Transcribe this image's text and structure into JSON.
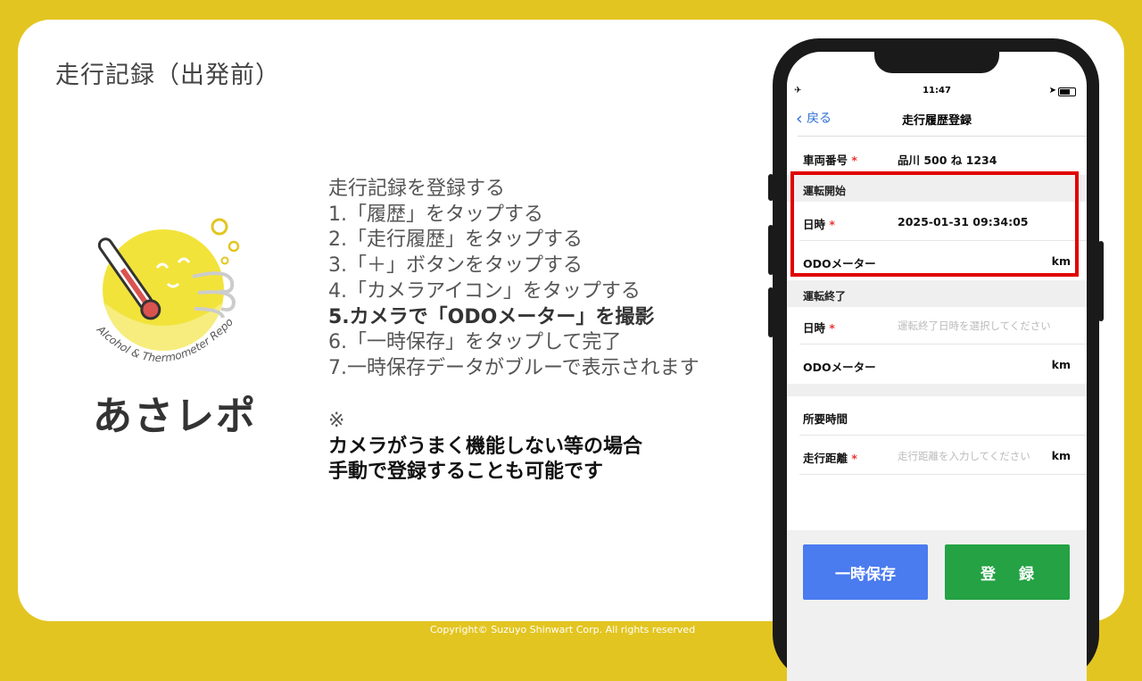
{
  "slide": {
    "title": "走行記録（出発前）",
    "steps": [
      "走行記録を登録する",
      "1.「履歴」をタップする",
      "2.「走行履歴」をタップする",
      "3.「＋」ボタンをタップする",
      "4.「カメラアイコン」をタップする",
      "5.カメラで「ODOメーター」を撮影",
      "6.「一時保存」をタップして完了",
      "7.一時保存データがブルーで表示されます"
    ],
    "note_mark": "※",
    "note_lines": [
      "カメラがうまく機能しない等の場合",
      "手動で登録することも可能です"
    ],
    "footer": "Copyright© Suzuyo Shinwart Corp. All rights reserved"
  },
  "logo": {
    "text": "あさレポ",
    "arc_text": "Alcohol & Thermometer Report",
    "colors": {
      "yellow": "#f2e33a",
      "dark_yellow": "#e3c521"
    }
  },
  "phone": {
    "status": {
      "time": "11:47",
      "plane_icon": "✈",
      "location_icon": "➤"
    },
    "nav": {
      "back_label": "戻る",
      "title": "走行履歴登録"
    },
    "vehicle": {
      "label": "車両番号",
      "value": "品川 500 ね 1234"
    },
    "start_section": "運転開始",
    "start_datetime": {
      "label": "日時",
      "value": "2025-01-31 09:34:05"
    },
    "start_odo": {
      "label": "ODOメーター",
      "unit": "km"
    },
    "end_section": "運転終了",
    "end_datetime": {
      "label": "日時",
      "placeholder": "運転終了日時を選択してください"
    },
    "end_odo": {
      "label": "ODOメーター",
      "unit": "km"
    },
    "duration": {
      "label": "所要時間"
    },
    "distance": {
      "label": "走行距離",
      "placeholder": "走行距離を入力してください",
      "unit": "km"
    },
    "required_mark": "*",
    "buttons": {
      "temp_save": "一時保存",
      "register": "登録"
    },
    "colors": {
      "blue": "#4a7bef",
      "green": "#24a244",
      "highlight": "#e00000"
    }
  }
}
